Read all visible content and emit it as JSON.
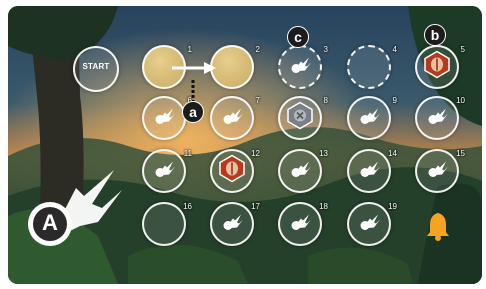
{
  "start": {
    "label": "START"
  },
  "markers": {
    "a": "a",
    "b": "b",
    "c": "c"
  },
  "player": {
    "letter": "A"
  },
  "colors": {
    "token_fill": "#d7bb7a",
    "red_tile": "#b83a1e",
    "grey_tile": "#7a7f86",
    "bell": "#f4a421",
    "path_dots": "#111111"
  },
  "spaces": [
    {
      "n": "1",
      "content": "filled"
    },
    {
      "n": "2",
      "content": "filled"
    },
    {
      "n": "3",
      "content": "comet"
    },
    {
      "n": "4",
      "content": "empty-dashed"
    },
    {
      "n": "5",
      "content": "red-hex"
    },
    {
      "n": "6",
      "content": "comet"
    },
    {
      "n": "7",
      "content": "comet"
    },
    {
      "n": "8",
      "content": "grey-hex"
    },
    {
      "n": "9",
      "content": "comet"
    },
    {
      "n": "10",
      "content": "comet"
    },
    {
      "n": "11",
      "content": "comet"
    },
    {
      "n": "12",
      "content": "red-hex"
    },
    {
      "n": "13",
      "content": "comet"
    },
    {
      "n": "14",
      "content": "comet"
    },
    {
      "n": "15",
      "content": "comet"
    },
    {
      "n": "16",
      "content": "empty"
    },
    {
      "n": "17",
      "content": "comet"
    },
    {
      "n": "18",
      "content": "comet"
    },
    {
      "n": "19",
      "content": "comet"
    }
  ],
  "icons": {
    "comet": "comet-icon",
    "red_hex": "red-hex-token-icon",
    "grey_hex": "grey-hex-token-icon",
    "bell": "bell-icon",
    "arrow": "move-arrow-icon",
    "player": "player-comet-icon"
  }
}
